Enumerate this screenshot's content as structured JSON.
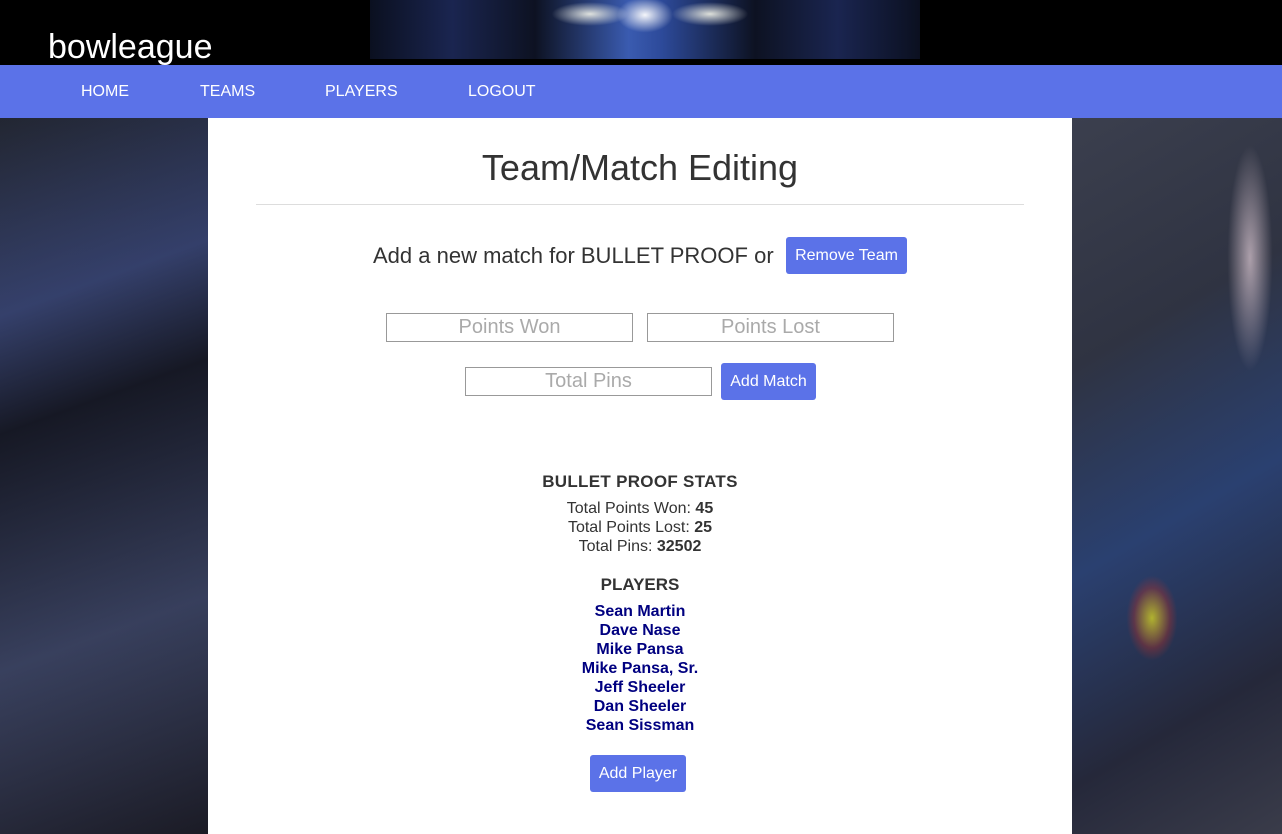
{
  "app": {
    "brand": "bowleague"
  },
  "nav": {
    "items": [
      {
        "label": "HOME"
      },
      {
        "label": "TEAMS"
      },
      {
        "label": "PLAYERS"
      },
      {
        "label": "LOGOUT"
      }
    ]
  },
  "page": {
    "title": "Team/Match Editing",
    "add_match_text": "Add a new match for BULLET PROOF or",
    "remove_team_label": "Remove Team",
    "points_won_placeholder": "Points Won",
    "points_lost_placeholder": "Points Lost",
    "total_pins_placeholder": "Total Pins",
    "add_match_label": "Add Match"
  },
  "stats": {
    "title": "BULLET PROOF STATS",
    "points_won_label": "Total Points Won: ",
    "points_won_value": "45",
    "points_lost_label": "Total Points Lost: ",
    "points_lost_value": "25",
    "total_pins_label": "Total Pins: ",
    "total_pins_value": "32502"
  },
  "players": {
    "title": "PLAYERS",
    "list": [
      "Sean Martin",
      "Dave Nase",
      "Mike Pansa",
      "Mike Pansa, Sr.",
      "Jeff Sheeler",
      "Dan Sheeler",
      "Sean Sissman"
    ],
    "add_player_label": "Add Player"
  }
}
